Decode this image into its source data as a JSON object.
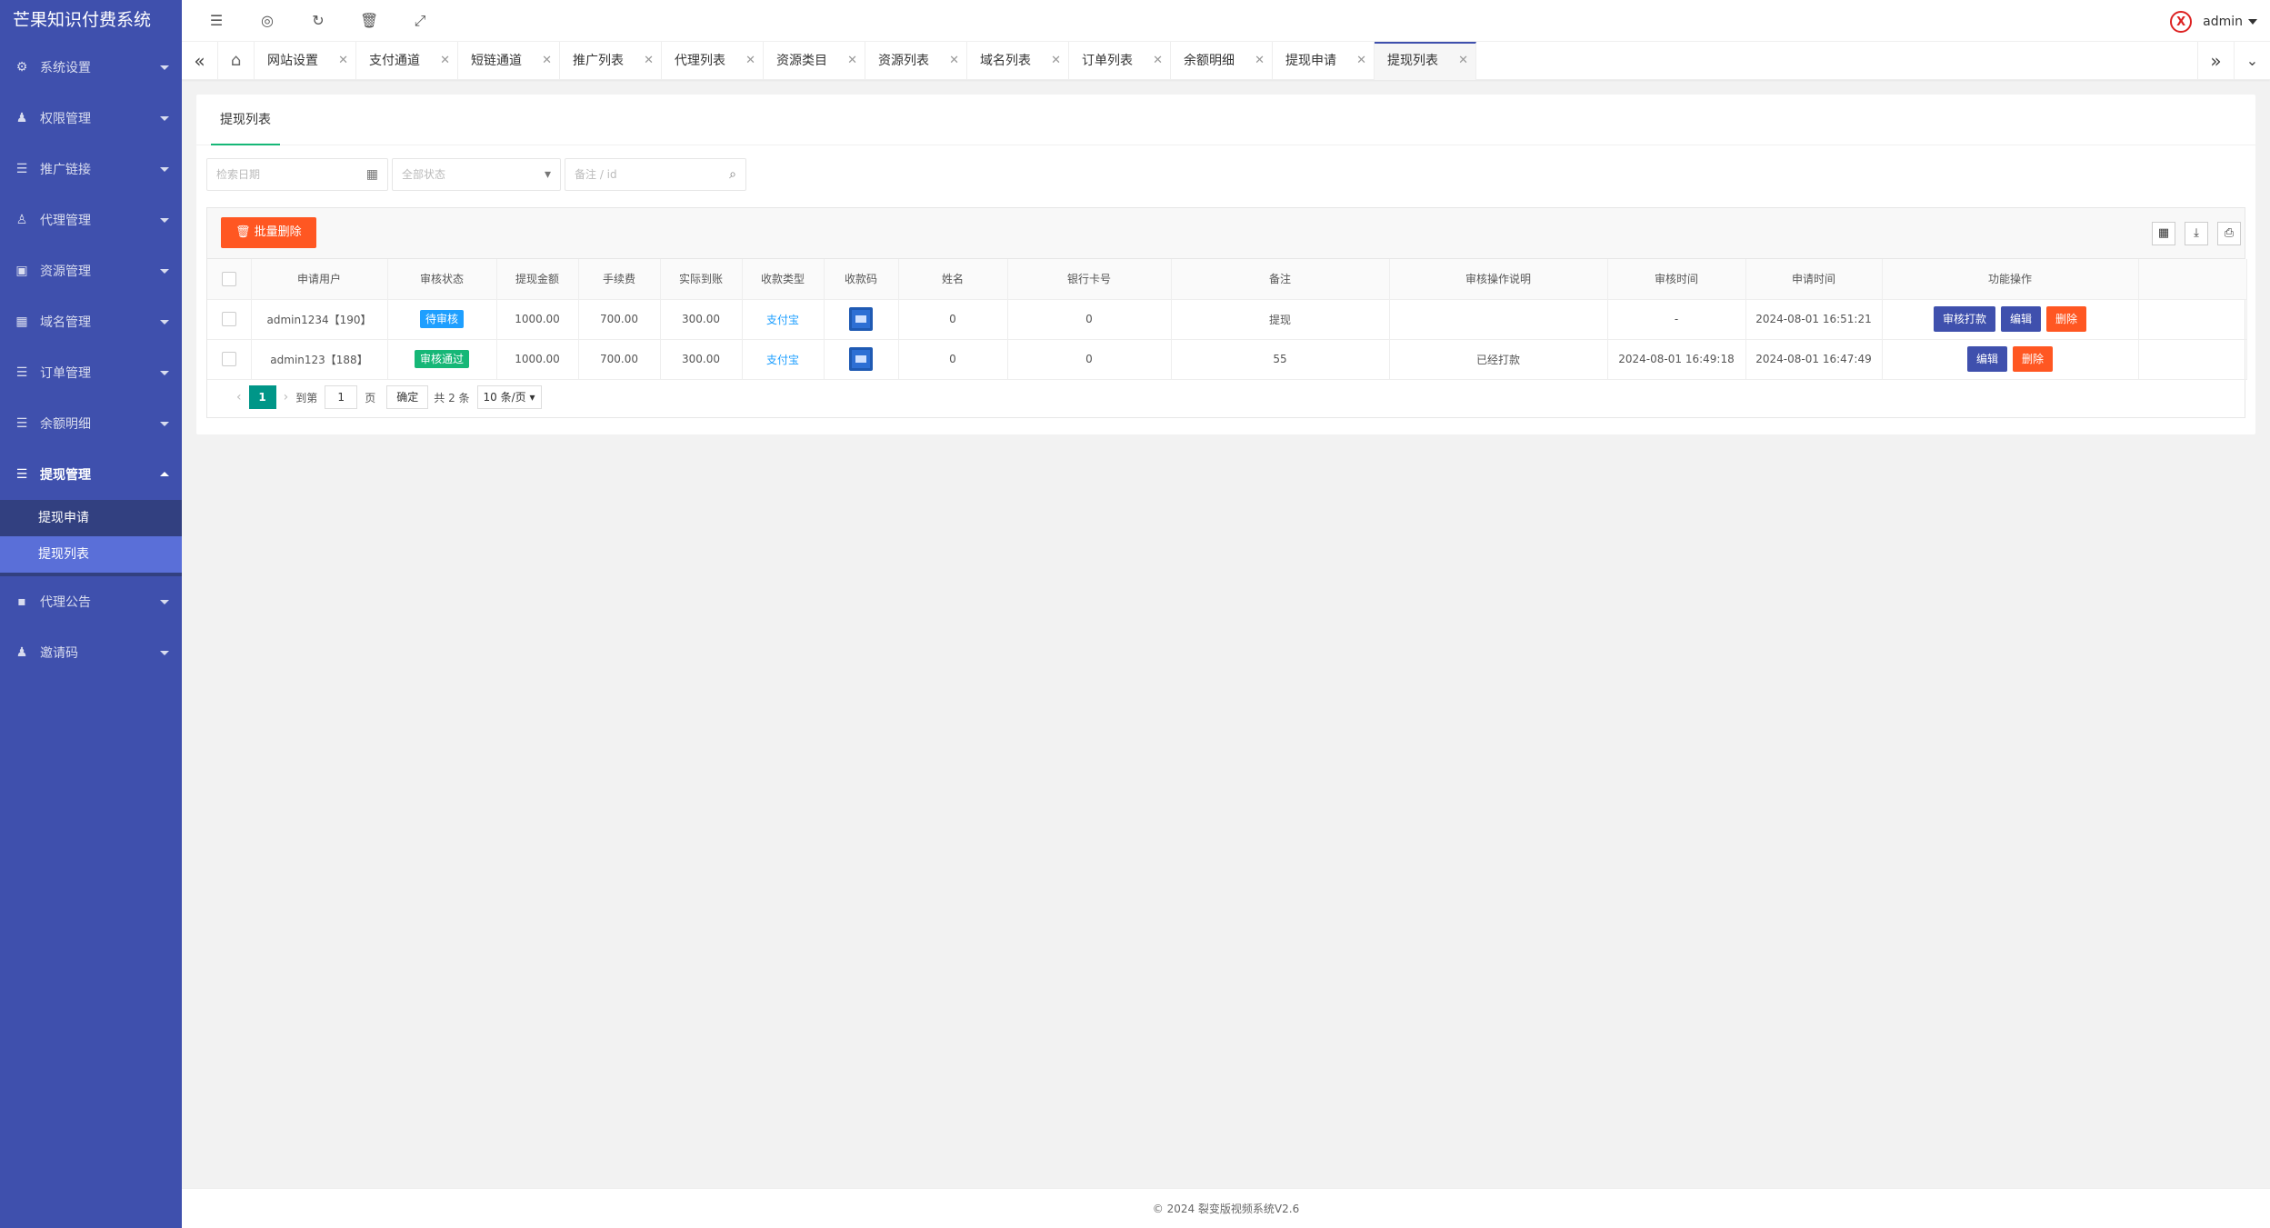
{
  "app": {
    "title": "芒果知识付费系统"
  },
  "sidebar": {
    "items": [
      {
        "label": "系统设置",
        "icon": "⚙"
      },
      {
        "label": "权限管理",
        "icon": "♟"
      },
      {
        "label": "推广链接",
        "icon": "☰"
      },
      {
        "label": "代理管理",
        "icon": "♙"
      },
      {
        "label": "资源管理",
        "icon": "▣"
      },
      {
        "label": "域名管理",
        "icon": "▦"
      },
      {
        "label": "订单管理",
        "icon": "☰"
      },
      {
        "label": "余额明细",
        "icon": "☰"
      },
      {
        "label": "提现管理",
        "icon": "☰"
      },
      {
        "label": "代理公告",
        "icon": "▪"
      },
      {
        "label": "邀请码",
        "icon": "♟"
      }
    ],
    "submenu": [
      {
        "label": "提现申请"
      },
      {
        "label": "提现列表"
      }
    ]
  },
  "header": {
    "user": "admin",
    "avatar_text": "X"
  },
  "tabs": [
    {
      "label": "网站设置"
    },
    {
      "label": "支付通道"
    },
    {
      "label": "短链通道"
    },
    {
      "label": "推广列表"
    },
    {
      "label": "代理列表"
    },
    {
      "label": "资源类目"
    },
    {
      "label": "资源列表"
    },
    {
      "label": "域名列表"
    },
    {
      "label": "订单列表"
    },
    {
      "label": "余额明细"
    },
    {
      "label": "提现申请"
    },
    {
      "label": "提现列表"
    }
  ],
  "panel": {
    "title": "提现列表"
  },
  "search": {
    "date_placeholder": "检索日期",
    "status_placeholder": "全部状态",
    "keyword_placeholder": "备注 / id"
  },
  "toolbar": {
    "batch_delete": "批量删除"
  },
  "table": {
    "headers": [
      "申请用户",
      "审核状态",
      "提现金额",
      "手续费",
      "实际到账",
      "收款类型",
      "收款码",
      "姓名",
      "银行卡号",
      "备注",
      "审核操作说明",
      "审核时间",
      "申请时间",
      "功能操作"
    ],
    "rows": [
      {
        "user": "admin1234【190】",
        "status": "待审核",
        "status_color": "#1e9fff",
        "amount": "1000.00",
        "fee": "700.00",
        "actual": "300.00",
        "type": "支付宝",
        "name": "0",
        "card": "0",
        "remark": "提现",
        "audit_note": "",
        "audit_time": "-",
        "apply_time": "2024-08-01 16:51:21",
        "ops": [
          "审核打款",
          "编辑",
          "删除"
        ]
      },
      {
        "user": "admin123【188】",
        "status": "审核通过",
        "status_color": "#16b777",
        "amount": "1000.00",
        "fee": "700.00",
        "actual": "300.00",
        "type": "支付宝",
        "name": "0",
        "card": "0",
        "remark": "55",
        "audit_note": "已经打款",
        "audit_time": "2024-08-01 16:49:18",
        "apply_time": "2024-08-01 16:47:49",
        "ops": [
          "编辑",
          "删除"
        ]
      }
    ]
  },
  "pager": {
    "current": "1",
    "goto_label": "到第",
    "page_input": "1",
    "page_unit": "页",
    "confirm": "确定",
    "total": "共 2 条",
    "page_size": "10 条/页"
  },
  "footer": {
    "text": "© 2024 裂变版视频系统V2.6"
  }
}
